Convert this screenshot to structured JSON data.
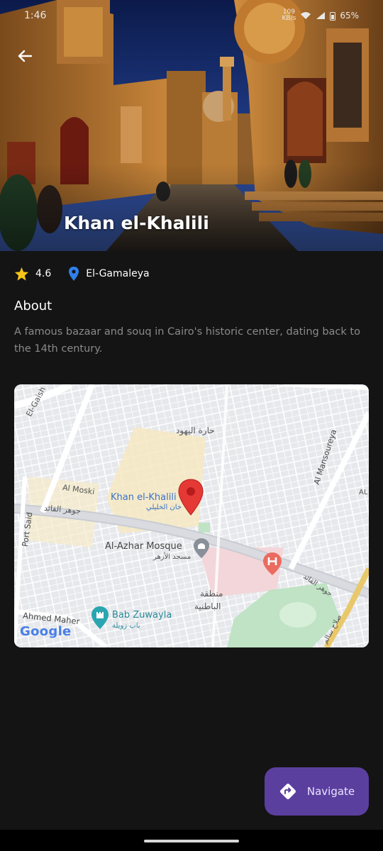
{
  "status_bar": {
    "time": "1:46",
    "speed": "109\nKB/s",
    "battery": "65%"
  },
  "place": {
    "title": "Khan el-Khalili",
    "rating": "4.6",
    "location": "El-Gamaleya",
    "about_heading": "About",
    "about_text": "A famous bazaar and souq in Cairo's historic center, dating back to the 14th century."
  },
  "map": {
    "labels": {
      "el_gaish": "El-Gaish",
      "haret_alyahud": "حارة اليهود",
      "al_mansoureya": "Al Mansoureya",
      "al_moski": "Al Moski",
      "gohar_alqaed_left": "جوهر القائد",
      "khan_en": "Khan el-Khalili",
      "khan_ar": "خان الخليلي",
      "port_said": "Port Said",
      "azhar_en": "Al-Azhar Mosque",
      "azhar_ar": "مسجد الأزهر",
      "gohar_alqaed_right": "جوهر القائد",
      "batneya_ar_1": "منطقة",
      "batneya_ar_2": "الباطنية",
      "ahmed_maher": "Ahmed Maher",
      "bab_zuwayla_en": "Bab Zuwayla",
      "bab_zuwayla_ar": "باب زويلة",
      "salah_salem": "صلاح سالم",
      "al_edge": "AL",
      "google": "Google"
    }
  },
  "actions": {
    "navigate_label": "Navigate"
  },
  "icons": {
    "back": "arrow-back-icon",
    "star": "star-icon",
    "location": "location-pin-icon",
    "navigate": "directions-icon",
    "map_pin": "map-pin-icon",
    "mosque": "mosque-icon",
    "hospital": "hospital-icon",
    "bab": "tower-icon"
  },
  "colors": {
    "background": "#141414",
    "star": "#f5c518",
    "location_pin": "#2f80ed",
    "fab": "#5b3f9f",
    "map_pin": "#e53935"
  }
}
